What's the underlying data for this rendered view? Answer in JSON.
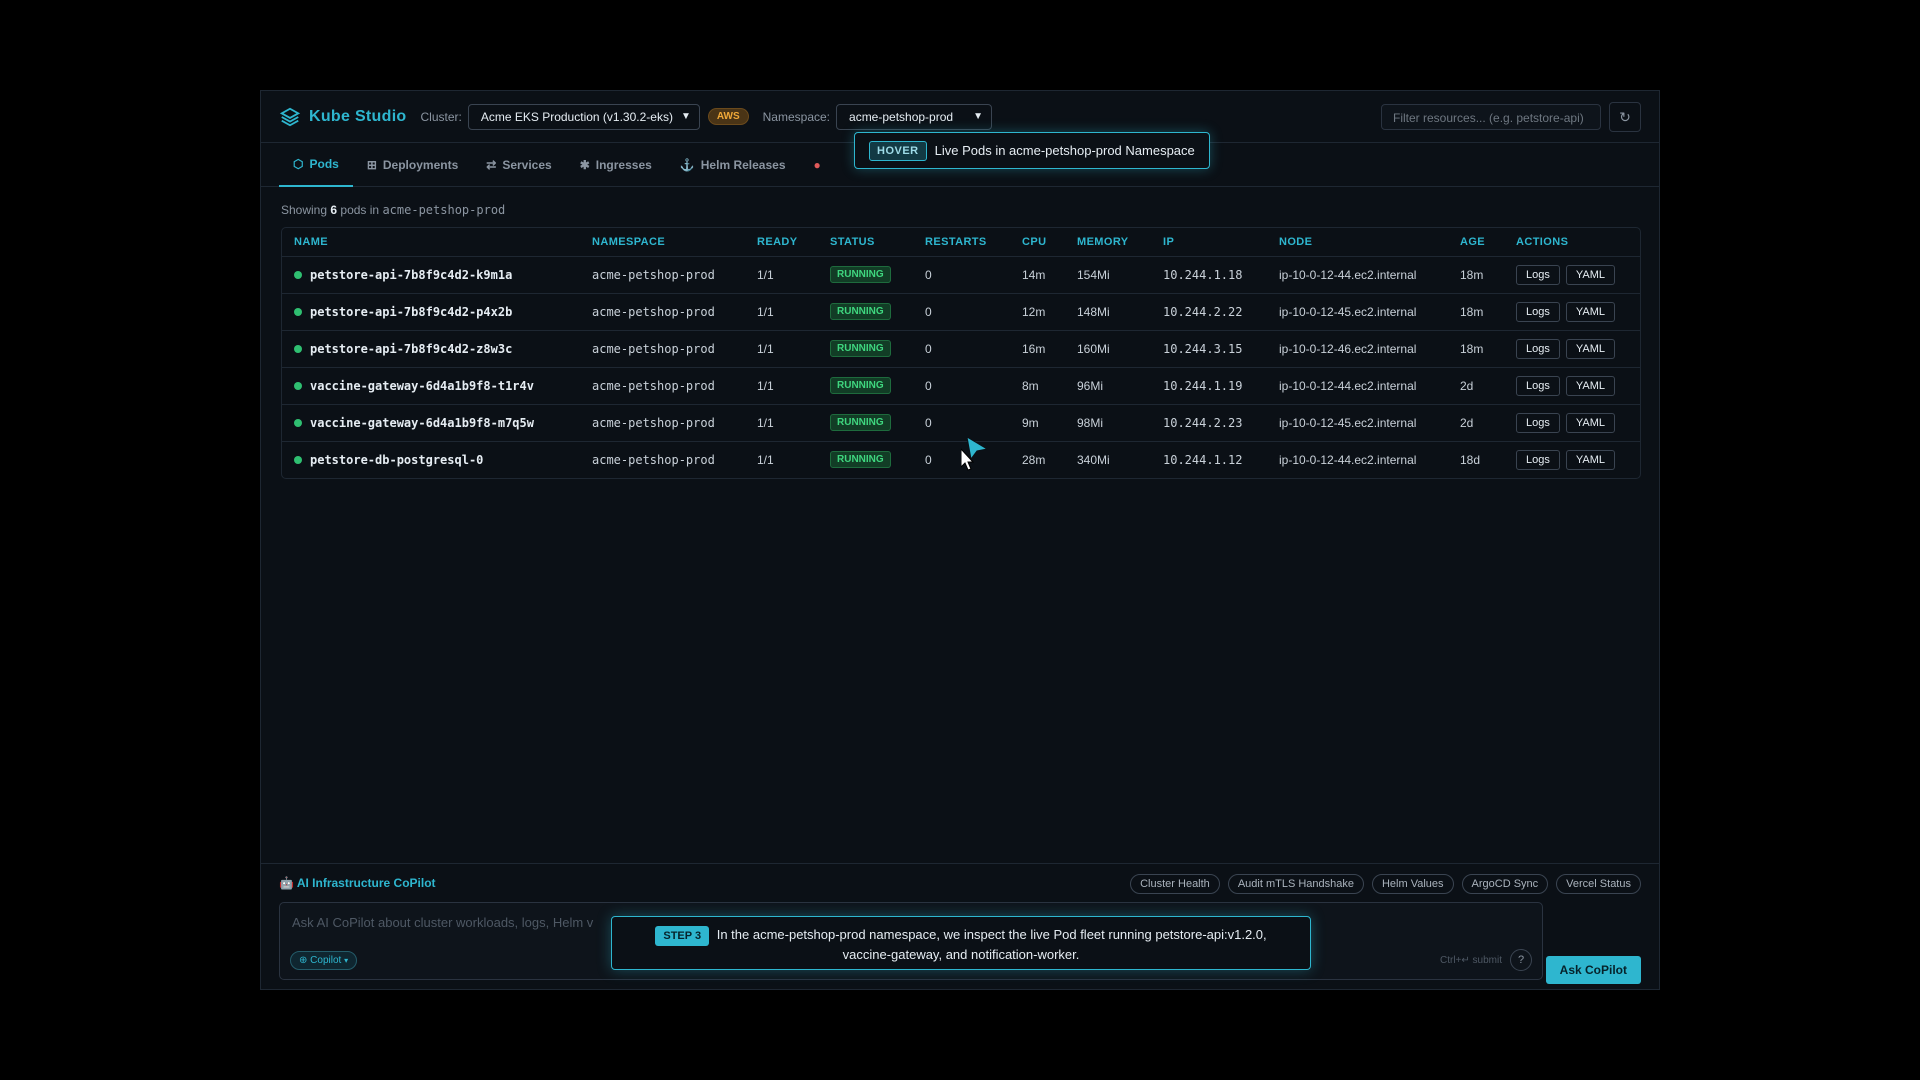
{
  "app": {
    "title": "Kube Studio",
    "colors": {
      "accent": "#2eb6cf",
      "running": "#3fd67f",
      "aws": "#f0a838"
    }
  },
  "header": {
    "cluster_label": "Cluster:",
    "cluster_value": "Acme EKS Production (v1.30.2-eks)",
    "provider_badge": "AWS",
    "namespace_label": "Namespace:",
    "namespace_value": "acme-petshop-prod",
    "filter_placeholder": "Filter resources... (e.g. petstore-api)",
    "refresh_icon": "refresh-icon"
  },
  "tabs": [
    {
      "label": "Pods",
      "icon": "pod-icon",
      "active": true
    },
    {
      "label": "Deployments",
      "icon": "grid-icon",
      "active": false
    },
    {
      "label": "Services",
      "icon": "arrows-icon",
      "active": false
    },
    {
      "label": "Ingresses",
      "icon": "asterisk-icon",
      "active": false
    },
    {
      "label": "Helm Releases",
      "icon": "anchor-icon",
      "active": false
    }
  ],
  "hover_tip": {
    "badge": "HOVER",
    "text": "Live Pods in acme-petshop-prod Namespace"
  },
  "summary": {
    "prefix": "Showing",
    "count": "6",
    "middle": "pods in",
    "namespace": "acme-petshop-prod"
  },
  "table": {
    "columns": [
      "NAME",
      "NAMESPACE",
      "READY",
      "STATUS",
      "RESTARTS",
      "CPU",
      "MEMORY",
      "IP",
      "NODE",
      "AGE",
      "ACTIONS"
    ],
    "rows": [
      {
        "name": "petstore-api-7b8f9c4d2-k9m1a",
        "namespace": "acme-petshop-prod",
        "ready": "1/1",
        "status": "RUNNING",
        "restarts": "0",
        "cpu": "14m",
        "memory": "154Mi",
        "ip": "10.244.1.18",
        "node": "ip-10-0-12-44.ec2.internal",
        "age": "18m"
      },
      {
        "name": "petstore-api-7b8f9c4d2-p4x2b",
        "namespace": "acme-petshop-prod",
        "ready": "1/1",
        "status": "RUNNING",
        "restarts": "0",
        "cpu": "12m",
        "memory": "148Mi",
        "ip": "10.244.2.22",
        "node": "ip-10-0-12-45.ec2.internal",
        "age": "18m"
      },
      {
        "name": "petstore-api-7b8f9c4d2-z8w3c",
        "namespace": "acme-petshop-prod",
        "ready": "1/1",
        "status": "RUNNING",
        "restarts": "0",
        "cpu": "16m",
        "memory": "160Mi",
        "ip": "10.244.3.15",
        "node": "ip-10-0-12-46.ec2.internal",
        "age": "18m"
      },
      {
        "name": "vaccine-gateway-6d4a1b9f8-t1r4v",
        "namespace": "acme-petshop-prod",
        "ready": "1/1",
        "status": "RUNNING",
        "restarts": "0",
        "cpu": "8m",
        "memory": "96Mi",
        "ip": "10.244.1.19",
        "node": "ip-10-0-12-44.ec2.internal",
        "age": "2d"
      },
      {
        "name": "vaccine-gateway-6d4a1b9f8-m7q5w",
        "namespace": "acme-petshop-prod",
        "ready": "1/1",
        "status": "RUNNING",
        "restarts": "0",
        "cpu": "9m",
        "memory": "98Mi",
        "ip": "10.244.2.23",
        "node": "ip-10-0-12-45.ec2.internal",
        "age": "2d"
      },
      {
        "name": "petstore-db-postgresql-0",
        "namespace": "acme-petshop-prod",
        "ready": "1/1",
        "status": "RUNNING",
        "restarts": "0",
        "cpu": "28m",
        "memory": "340Mi",
        "ip": "10.244.1.12",
        "node": "ip-10-0-12-44.ec2.internal",
        "age": "18d"
      }
    ],
    "actions": {
      "logs": "Logs",
      "yaml": "YAML"
    }
  },
  "copilot": {
    "title": "AI Infrastructure CoPilot",
    "chips": [
      "Cluster Health",
      "Audit mTLS Handshake",
      "Helm Values",
      "ArgoCD Sync",
      "Vercel Status"
    ],
    "placeholder": "Ask AI CoPilot about cluster workloads, logs, Helm v",
    "model": "Copilot",
    "hint": "Ctrl+↵ submit",
    "help": "?",
    "ask_button": "Ask CoPilot"
  },
  "step_tip": {
    "badge": "STEP 3",
    "line1": "In the acme-petshop-prod namespace, we inspect the live Pod fleet running petstore-api:v1.2.0,",
    "line2": "vaccine-gateway, and notification-worker."
  }
}
